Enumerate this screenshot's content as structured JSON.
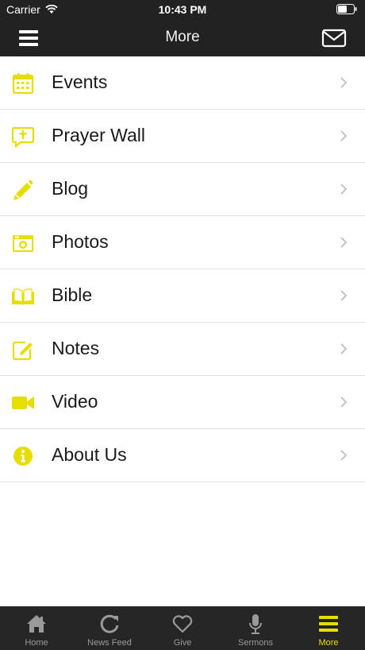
{
  "status_bar": {
    "carrier": "Carrier",
    "time": "10:43 PM"
  },
  "nav": {
    "title": "More"
  },
  "menu_items": [
    {
      "label": "Events",
      "icon": "calendar-icon"
    },
    {
      "label": "Prayer Wall",
      "icon": "prayer-bubble-icon"
    },
    {
      "label": "Blog",
      "icon": "pencil-icon"
    },
    {
      "label": "Photos",
      "icon": "camera-icon"
    },
    {
      "label": "Bible",
      "icon": "book-icon"
    },
    {
      "label": "Notes",
      "icon": "edit-note-icon"
    },
    {
      "label": "Video",
      "icon": "video-camera-icon"
    },
    {
      "label": "About Us",
      "icon": "info-icon"
    }
  ],
  "tabs": [
    {
      "label": "Home",
      "icon": "home-icon"
    },
    {
      "label": "News Feed",
      "icon": "refresh-icon"
    },
    {
      "label": "Give",
      "icon": "heart-icon"
    },
    {
      "label": "Sermons",
      "icon": "microphone-icon"
    },
    {
      "label": "More",
      "icon": "menu-icon",
      "active": true
    }
  ],
  "colors": {
    "accent": "#e8dd00",
    "bar_bg": "#222222",
    "tab_inactive": "#9a9a9a"
  }
}
